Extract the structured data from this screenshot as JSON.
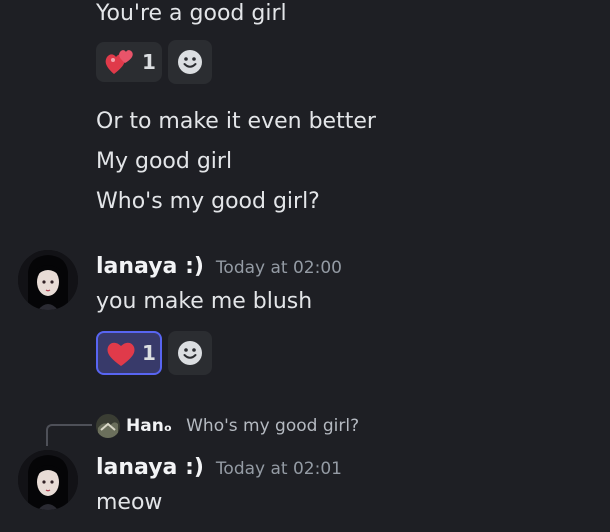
{
  "messages_top": {
    "lines": [
      "You're a good girl",
      "Or to make it even better",
      "My good girl",
      "Who's my good girl?"
    ],
    "reaction_count": "1"
  },
  "message_1": {
    "username": "lanaya :)",
    "timestamp": "Today at 02:00",
    "text": "you make me blush",
    "reaction_count": "1"
  },
  "reply": {
    "username": "Hanₒ",
    "text": "Who's my good girl?"
  },
  "message_2": {
    "username": "lanaya :)",
    "timestamp": "Today at 02:01",
    "text": "meow"
  },
  "icons": {
    "heart_reaction": "heart-icon",
    "hearts_reaction": "two-hearts-icon",
    "add_reaction": "smiley-icon"
  },
  "colors": {
    "background": "#1e1f24",
    "reaction_active_border": "#5865f2",
    "heart": "#e03a4a"
  }
}
